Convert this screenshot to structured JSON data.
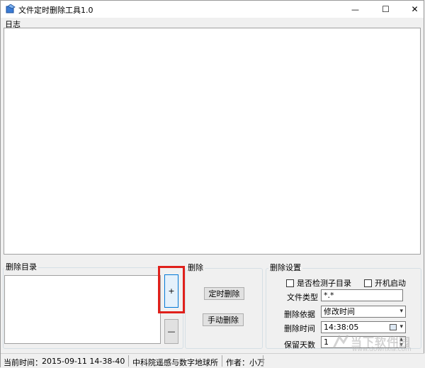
{
  "window": {
    "title": "文件定时删除工具1.0",
    "minimize_glyph": "—",
    "maximize_glyph": "☐",
    "close_glyph": "✕"
  },
  "log": {
    "label": "日志"
  },
  "delete_dir": {
    "label": "删除目录",
    "add_label": "+",
    "remove_label": "—"
  },
  "delete": {
    "label": "删除",
    "timed_label": "定时删除",
    "manual_label": "手动删除"
  },
  "settings": {
    "label": "删除设置",
    "check_subdir_label": "是否检测子目录",
    "autostart_label": "开机启动",
    "file_type_label": "文件类型",
    "file_type_value": "*.*",
    "basis_label": "删除依据",
    "basis_value": "修改时间",
    "time_label": "删除时间",
    "time_value": "14:38:05",
    "keep_days_label": "保留天数",
    "keep_days_value": "1"
  },
  "status": {
    "current_time_label": "当前时间：",
    "current_time_value": "2015-09-11 14-38-40",
    "org": "中科院遥感与数字地球所",
    "author": "作者：小万"
  },
  "watermark": {
    "text": "当下软件园",
    "url": "www.downxia.com"
  },
  "colors": {
    "highlight": "#e0201b",
    "accent": "#0078d7"
  }
}
